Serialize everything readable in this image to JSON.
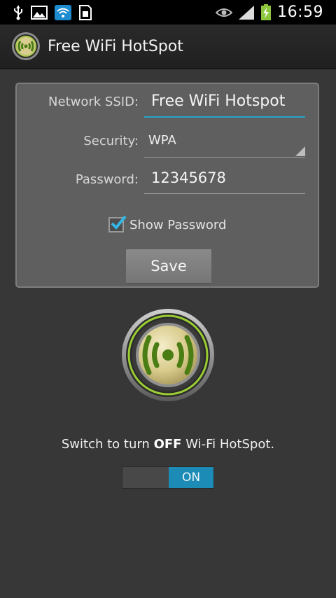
{
  "status_bar": {
    "time": "16:59",
    "icons": [
      "usb-icon",
      "image-notification-icon",
      "wifi-hotspot-notification-icon",
      "sd-card-icon",
      "eye-icon",
      "signal-icon",
      "battery-charging-icon"
    ]
  },
  "action_bar": {
    "title": "Free WiFi HotSpot",
    "icon": "hotspot-app-icon"
  },
  "form": {
    "ssid_label": "Network SSID:",
    "ssid_value": "Free WiFi Hotspot",
    "security_label": "Security:",
    "security_value": "WPA",
    "password_label": "Password:",
    "password_value": "12345678",
    "show_password_label": "Show Password",
    "show_password_checked": true,
    "save_label": "Save"
  },
  "main": {
    "switch_text_prefix": "Switch to turn ",
    "switch_text_bold": "OFF",
    "switch_text_suffix": " Wi-Fi HotSpot.",
    "toggle_label": "ON",
    "toggle_state": "on"
  },
  "colors": {
    "accent": "#29a3c9",
    "toggle_on": "#1c8bb5",
    "hotspot_green": "#7fb32a",
    "background": "#373737"
  }
}
